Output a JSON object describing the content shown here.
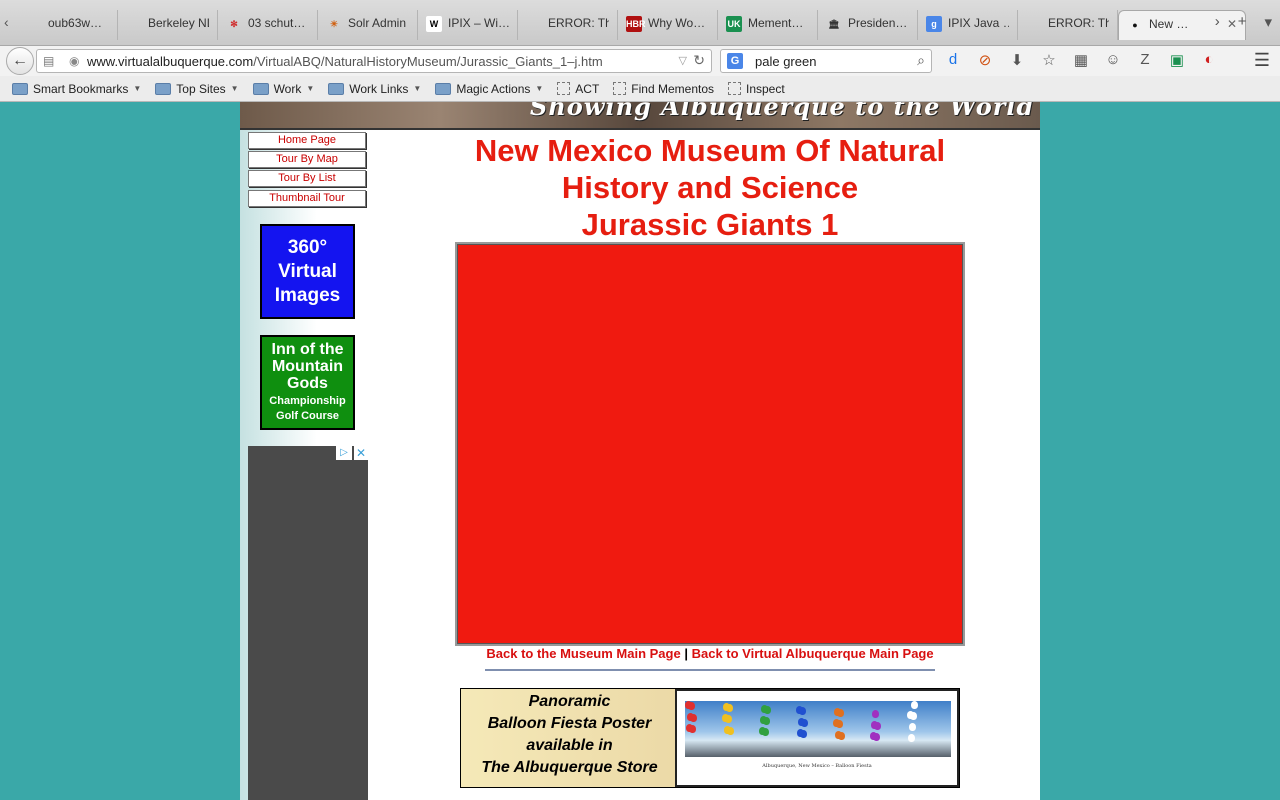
{
  "browser": {
    "tabs": [
      {
        "title": "oub63w…",
        "icon": "page-icon",
        "active": false
      },
      {
        "title": "Berkeley NLP…",
        "icon": "page-icon",
        "active": false
      },
      {
        "title": "03 schut…",
        "icon": "cluster-icon",
        "active": false
      },
      {
        "title": "Solr Admin",
        "icon": "solr-icon",
        "active": false
      },
      {
        "title": "IPIX – Wi…",
        "icon": "wikipedia-icon",
        "active": false
      },
      {
        "title": "ERROR: The r…",
        "icon": "page-icon",
        "active": false
      },
      {
        "title": "Why Wo…",
        "icon": "hbr-icon",
        "active": false
      },
      {
        "title": "Mement…",
        "icon": "ukwa-icon",
        "active": false
      },
      {
        "title": "Presiden…",
        "icon": "building-icon",
        "active": false
      },
      {
        "title": "IPIX Java …",
        "icon": "google-icon",
        "active": false
      },
      {
        "title": "ERROR: The r…",
        "icon": "page-icon",
        "active": false
      },
      {
        "title": "New …",
        "icon": "open-icon",
        "active": true
      }
    ],
    "url": {
      "domain": "www.virtualalbuquerque.com",
      "path": "/VirtualABQ/NaturalHistoryMuseum/Jurassic_Giants_1–j.htm"
    },
    "search": {
      "value": "pale green",
      "engine": "G"
    },
    "bookmarks": [
      {
        "label": "Smart Bookmarks",
        "icon": "folder-icon",
        "menu": true
      },
      {
        "label": "Top Sites",
        "icon": "folder-icon",
        "menu": true
      },
      {
        "label": "Work",
        "icon": "folder-icon",
        "menu": true
      },
      {
        "label": "Work Links",
        "icon": "folder-icon",
        "menu": true
      },
      {
        "label": "Magic Actions",
        "icon": "folder-icon",
        "menu": true
      },
      {
        "label": "ACT",
        "icon": "bookmarklet-icon",
        "menu": false
      },
      {
        "label": "Find Mementos",
        "icon": "bookmarklet-icon",
        "menu": false
      },
      {
        "label": "Inspect",
        "icon": "bookmarklet-icon",
        "menu": false
      }
    ]
  },
  "page": {
    "banner_text": "Showing Albuquerque to the World",
    "nav": [
      "Home Page",
      "Tour By Map",
      "Tour By List",
      "Thumbnail Tour"
    ],
    "ad_360": [
      "360°",
      "Virtual",
      "Images"
    ],
    "ad_golf": {
      "lines": [
        "Inn of the",
        "Mountain",
        "Gods"
      ],
      "sub": [
        "Championship",
        "Golf Course"
      ]
    },
    "title_lines": [
      "New Mexico Museum Of Natural",
      "History and Science",
      "Jurassic Giants 1"
    ],
    "links": {
      "museum": "Back to the Museum Main Page",
      "separator": "|",
      "home": "Back to Virtual Albuquerque Main Page"
    },
    "poster": {
      "lines": [
        "Panoramic",
        "Balloon Fiesta Poster",
        "available in",
        "The Albuquerque Store"
      ],
      "caption": "Albuquerque, New Mexico – Balloon Fiesta"
    },
    "colors": {
      "background": "#3aa8a8",
      "title": "#e61e10",
      "viewer": "#f01a10",
      "ad_360": "#1414f0",
      "ad_golf": "#0f8f0f"
    }
  }
}
